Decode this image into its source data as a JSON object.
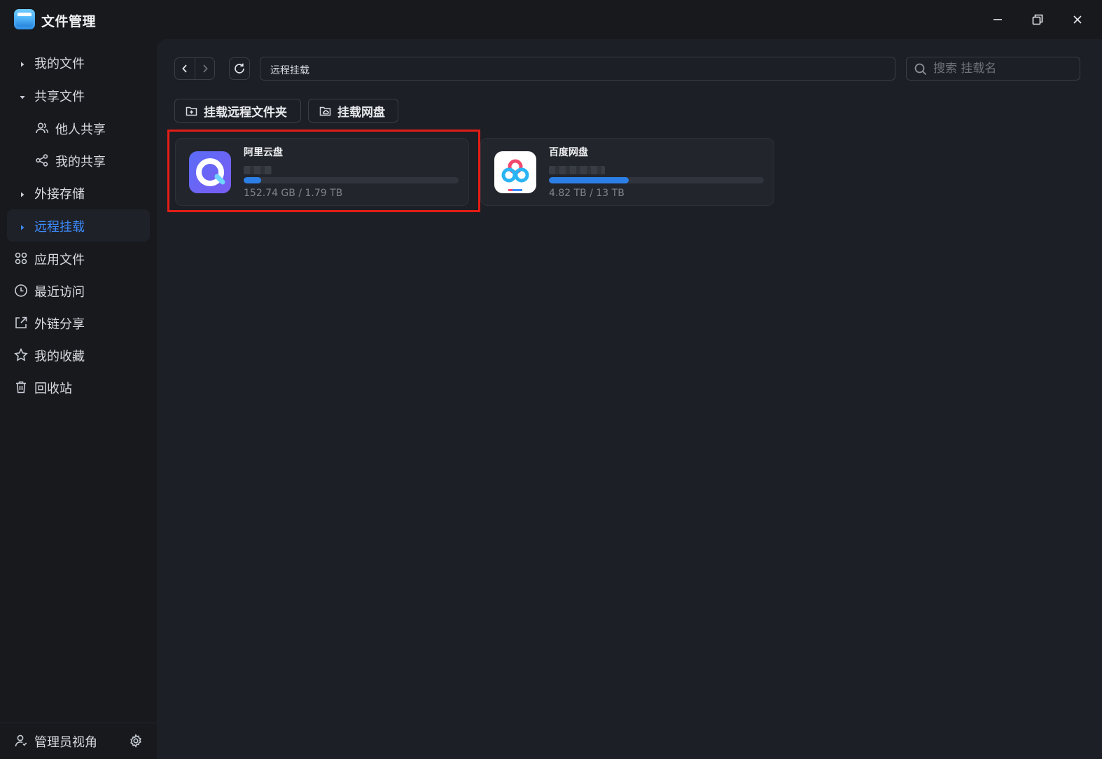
{
  "app": {
    "title": "文件管理"
  },
  "sidebar": {
    "items": [
      {
        "label": "我的文件",
        "icon": "caret-right-icon"
      },
      {
        "label": "共享文件",
        "icon": "caret-down-icon"
      },
      {
        "label": "他人共享",
        "icon": "users-icon"
      },
      {
        "label": "我的共享",
        "icon": "share-icon"
      },
      {
        "label": "外接存储",
        "icon": "caret-right-icon"
      },
      {
        "label": "远程挂载",
        "icon": "caret-right-icon",
        "active": true
      },
      {
        "label": "应用文件",
        "icon": "apps-icon"
      },
      {
        "label": "最近访问",
        "icon": "clock-icon"
      },
      {
        "label": "外链分享",
        "icon": "external-share-icon"
      },
      {
        "label": "我的收藏",
        "icon": "star-icon"
      },
      {
        "label": "回收站",
        "icon": "trash-icon"
      }
    ],
    "footer": {
      "label": "管理员视角",
      "icon": "admin-user-icon",
      "settings_icon": "gear-icon"
    }
  },
  "toolbar": {
    "path": "远程挂载",
    "search_placeholder": "搜索 挂载名"
  },
  "actions": {
    "mount_folder": "挂载远程文件夹",
    "mount_disk": "挂载网盘"
  },
  "mounts": [
    {
      "name": "阿里云盘",
      "usage": "152.74 GB / 1.79 TB",
      "used_fraction": 0.083,
      "logo": "aliyun-drive-logo"
    },
    {
      "name": "百度网盘",
      "usage": "4.82 TB / 13 TB",
      "used_fraction": 0.371,
      "logo": "baidu-netdisk-logo"
    }
  ],
  "colors": {
    "accent": "#3d8bfd",
    "progress": "#2d7fe8",
    "highlight": "#e21d16",
    "background": "#17191d",
    "panel": "#1c1f25"
  }
}
